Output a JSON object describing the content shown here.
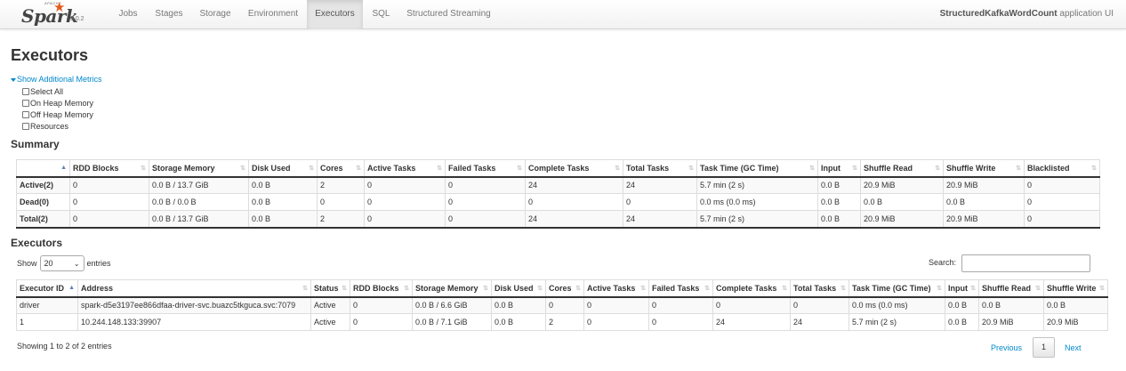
{
  "navbar": {
    "logo_apache": "APACHE",
    "logo_name": "Spark",
    "logo_version": "3.0.2",
    "tabs": [
      {
        "label": "Jobs",
        "active": false
      },
      {
        "label": "Stages",
        "active": false
      },
      {
        "label": "Storage",
        "active": false
      },
      {
        "label": "Environment",
        "active": false
      },
      {
        "label": "Executors",
        "active": true
      },
      {
        "label": "SQL",
        "active": false
      },
      {
        "label": "Structured Streaming",
        "active": false
      }
    ],
    "app_name": "StructuredKafkaWordCount",
    "app_suffix": " application UI"
  },
  "page_title": "Executors",
  "additional_metrics": {
    "toggle_label": "Show Additional Metrics",
    "options": [
      {
        "label": "Select All",
        "checked": false
      },
      {
        "label": "On Heap Memory",
        "checked": false
      },
      {
        "label": "Off Heap Memory",
        "checked": false
      },
      {
        "label": "Resources",
        "checked": false
      }
    ]
  },
  "summary": {
    "title": "Summary",
    "columns": [
      "",
      "RDD Blocks",
      "Storage Memory",
      "Disk Used",
      "Cores",
      "Active Tasks",
      "Failed Tasks",
      "Complete Tasks",
      "Total Tasks",
      "Task Time (GC Time)",
      "Input",
      "Shuffle Read",
      "Shuffle Write",
      "Blacklisted"
    ],
    "rows": [
      [
        "Active(2)",
        "0",
        "0.0 B / 13.7 GiB",
        "0.0 B",
        "2",
        "0",
        "0",
        "24",
        "24",
        "5.7 min (2 s)",
        "0.0 B",
        "20.9 MiB",
        "20.9 MiB",
        "0"
      ],
      [
        "Dead(0)",
        "0",
        "0.0 B / 0.0 B",
        "0.0 B",
        "0",
        "0",
        "0",
        "0",
        "0",
        "0.0 ms (0.0 ms)",
        "0.0 B",
        "0.0 B",
        "0.0 B",
        "0"
      ],
      [
        "Total(2)",
        "0",
        "0.0 B / 13.7 GiB",
        "0.0 B",
        "2",
        "0",
        "0",
        "24",
        "24",
        "5.7 min (2 s)",
        "0.0 B",
        "20.9 MiB",
        "20.9 MiB",
        "0"
      ]
    ]
  },
  "executors": {
    "title": "Executors",
    "show_label": "Show",
    "page_size": "20",
    "entries_label": "entries",
    "search_label": "Search:",
    "search_value": "",
    "columns": [
      "Executor ID",
      "Address",
      "Status",
      "RDD Blocks",
      "Storage Memory",
      "Disk Used",
      "Cores",
      "Active Tasks",
      "Failed Tasks",
      "Complete Tasks",
      "Total Tasks",
      "Task Time (GC Time)",
      "Input",
      "Shuffle Read",
      "Shuffle Write"
    ],
    "rows": [
      [
        "driver",
        "spark-d5e3197ee866dfaa-driver-svc.buazc5tkguca.svc:7079",
        "Active",
        "0",
        "0.0 B / 6.6 GiB",
        "0.0 B",
        "0",
        "0",
        "0",
        "0",
        "0",
        "0.0 ms (0.0 ms)",
        "0.0 B",
        "0.0 B",
        "0.0 B"
      ],
      [
        "1",
        "10.244.148.133:39907",
        "Active",
        "0",
        "0.0 B / 7.1 GiB",
        "0.0 B",
        "2",
        "0",
        "0",
        "24",
        "24",
        "5.7 min (2 s)",
        "0.0 B",
        "20.9 MiB",
        "20.9 MiB"
      ]
    ],
    "info": "Showing 1 to 2 of 2 entries",
    "pagination": {
      "previous": "Previous",
      "current": "1",
      "next": "Next"
    }
  },
  "colors": {
    "link": "#0088cc",
    "spark_orange": "#e25a1c",
    "active_tab_bg": "#e5e5e5"
  },
  "icons": {
    "toggle": "caret-down-icon",
    "logo": "spark-star-icon",
    "sort": "sort-arrow-icon",
    "select": "chevron-down-icon"
  }
}
